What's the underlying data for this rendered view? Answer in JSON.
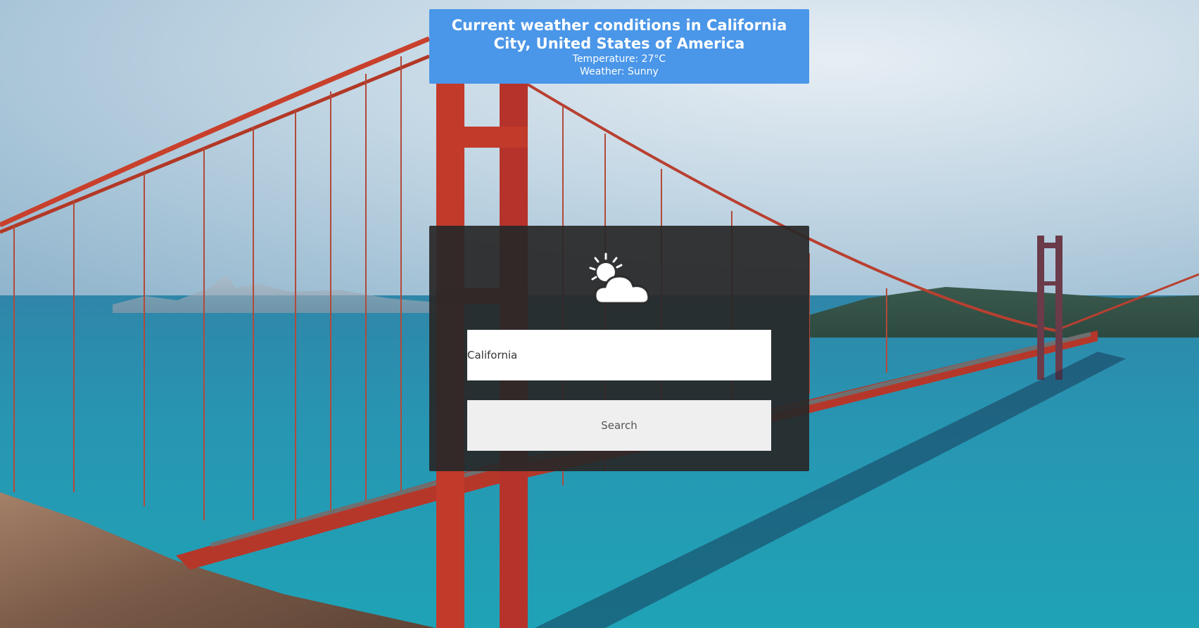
{
  "header": {
    "title": "Current weather conditions in California City, United States of America",
    "temperature": "Temperature: 27°C",
    "weather": "Weather: Sunny"
  },
  "search": {
    "input_value": "California",
    "button_label": "Search",
    "icon": "partly-cloudy-icon"
  }
}
